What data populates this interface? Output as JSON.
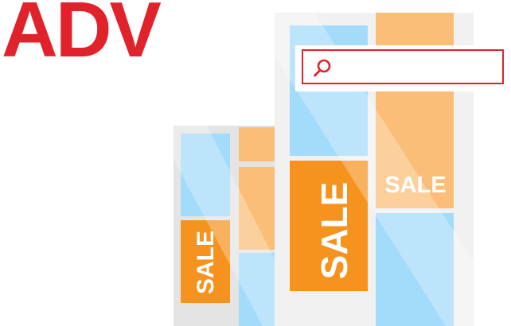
{
  "logo": {
    "text": "ADV",
    "color": "#e0222b"
  },
  "search": {
    "placeholder": "",
    "value": "",
    "icon": "search-icon"
  },
  "tiles": {
    "sale_small_left": "SALE",
    "sale_large_center": "SALE",
    "sale_right": "SALE"
  },
  "colors": {
    "accent_red": "#e0222b",
    "sale_orange": "#f6931f",
    "light_orange": "#fbbe78",
    "light_blue": "#a3dcfb",
    "frame_gray": "#e8e8e8"
  }
}
